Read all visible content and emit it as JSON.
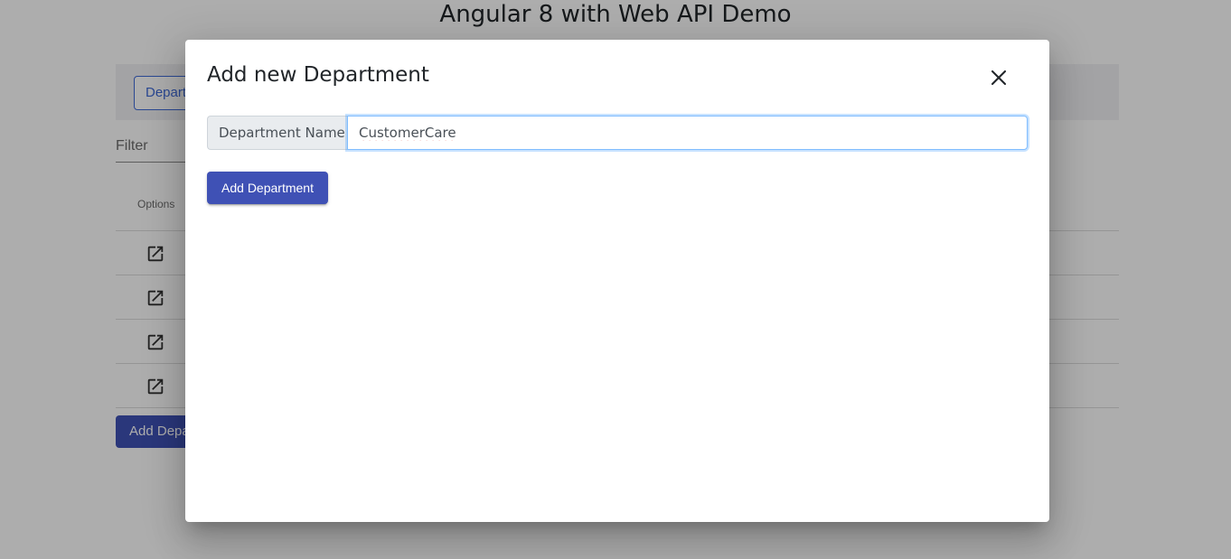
{
  "page": {
    "title": "Angular 8 with Web API Demo"
  },
  "background": {
    "nav_tab_label": "Departments",
    "filter_label": "Filter",
    "table": {
      "column_options": "Options",
      "row_count": 4,
      "row_icon": "open-in-new-icon"
    },
    "add_button_label": "Add Department"
  },
  "dialog": {
    "title": "Add new Department",
    "close_icon": "close-icon",
    "field_label": "Department Name",
    "field_value": "CustomerCare",
    "submit_label": "Add Department"
  },
  "colors": {
    "primary": "#3f51b5",
    "nav_outline": "#3f6ad8",
    "focus_border": "#80bdff"
  }
}
